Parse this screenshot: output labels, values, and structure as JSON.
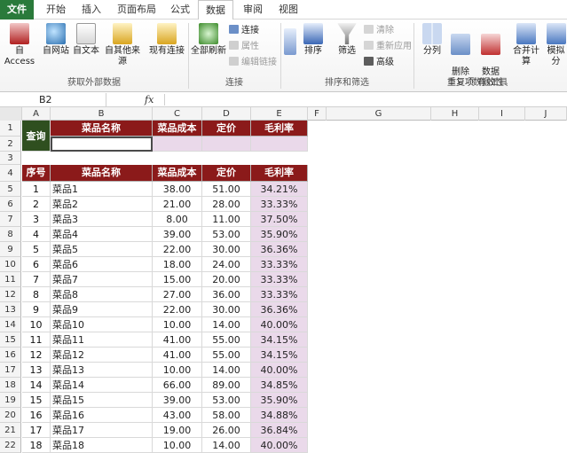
{
  "tabs": [
    "文件",
    "开始",
    "插入",
    "页面布局",
    "公式",
    "数据",
    "审阅",
    "视图"
  ],
  "active_tab": "数据",
  "ribbon": {
    "get_external": {
      "label": "获取外部数据",
      "buttons": [
        "自 Access",
        "自网站",
        "自文本",
        "自其他来源",
        "现有连接"
      ]
    },
    "connections": {
      "label": "连接",
      "refresh_all": "全部刷新",
      "items": [
        "连接",
        "属性",
        "编辑链接"
      ]
    },
    "sort_filter": {
      "label": "排序和筛选",
      "sort": "排序",
      "filter": "筛选",
      "items": [
        "清除",
        "重新应用",
        "高级"
      ]
    },
    "data_tools": {
      "label": "数据工具",
      "buttons": [
        "分列",
        "删除\n重复项",
        "数据\n有效性",
        "合并计算",
        "模拟分"
      ]
    }
  },
  "formula_bar": {
    "name_box": "B2",
    "fx": "fx",
    "content": ""
  },
  "columns": [
    "A",
    "B",
    "C",
    "D",
    "E",
    "F",
    "G",
    "H",
    "I",
    "J"
  ],
  "query": {
    "label": "查询",
    "headers": [
      "菜品名称",
      "菜品成本",
      "定价",
      "毛利率"
    ],
    "values": [
      "",
      "",
      "",
      ""
    ]
  },
  "table": {
    "headers": [
      "序号",
      "菜品名称",
      "菜品成本",
      "定价",
      "毛利率"
    ],
    "rows": [
      [
        "1",
        "菜品1",
        "38.00",
        "51.00",
        "34.21%"
      ],
      [
        "2",
        "菜品2",
        "21.00",
        "28.00",
        "33.33%"
      ],
      [
        "3",
        "菜品3",
        "8.00",
        "11.00",
        "37.50%"
      ],
      [
        "4",
        "菜品4",
        "39.00",
        "53.00",
        "35.90%"
      ],
      [
        "5",
        "菜品5",
        "22.00",
        "30.00",
        "36.36%"
      ],
      [
        "6",
        "菜品6",
        "18.00",
        "24.00",
        "33.33%"
      ],
      [
        "7",
        "菜品7",
        "15.00",
        "20.00",
        "33.33%"
      ],
      [
        "8",
        "菜品8",
        "27.00",
        "36.00",
        "33.33%"
      ],
      [
        "9",
        "菜品9",
        "22.00",
        "30.00",
        "36.36%"
      ],
      [
        "10",
        "菜品10",
        "10.00",
        "14.00",
        "40.00%"
      ],
      [
        "11",
        "菜品11",
        "41.00",
        "55.00",
        "34.15%"
      ],
      [
        "12",
        "菜品12",
        "41.00",
        "55.00",
        "34.15%"
      ],
      [
        "13",
        "菜品13",
        "10.00",
        "14.00",
        "40.00%"
      ],
      [
        "14",
        "菜品14",
        "66.00",
        "89.00",
        "34.85%"
      ],
      [
        "15",
        "菜品15",
        "39.00",
        "53.00",
        "35.90%"
      ],
      [
        "16",
        "菜品16",
        "43.00",
        "58.00",
        "34.88%"
      ],
      [
        "17",
        "菜品17",
        "19.00",
        "26.00",
        "36.84%"
      ],
      [
        "18",
        "菜品18",
        "10.00",
        "14.00",
        "40.00%"
      ]
    ]
  },
  "row_numbers": [
    "1",
    "2",
    "3",
    "4",
    "5",
    "6",
    "7",
    "8",
    "9",
    "10",
    "11",
    "12",
    "13",
    "14",
    "15",
    "16",
    "17",
    "18",
    "19",
    "20",
    "21",
    "22"
  ],
  "colors": {
    "file_tab": "#2a7a3b",
    "header_fill": "#8b1a1a",
    "query_fill": "#2f4f1f",
    "margin_fill": "#ead9ea"
  }
}
